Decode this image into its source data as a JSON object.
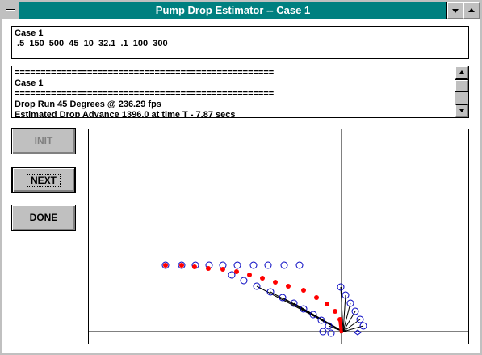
{
  "window": {
    "title": "Pump Drop Estimator -- Case 1"
  },
  "input_box": {
    "line1": "Case 1",
    "line2": " .5  150  500  45  10  32.1  .1  100  300"
  },
  "log": {
    "lines": [
      "==================================================",
      "Case 1",
      "==================================================",
      "Drop Run 45 Degrees @ 236.29 fps",
      "Estimated Drop Advance 1396.0 at time T - 7.87 secs"
    ]
  },
  "buttons": {
    "init": "INIT",
    "next": "NEXT",
    "done": "DONE"
  },
  "colors": {
    "title_bar": "#008080",
    "open_circle": "#0000c0",
    "filled_dot": "#ff0000"
  }
}
